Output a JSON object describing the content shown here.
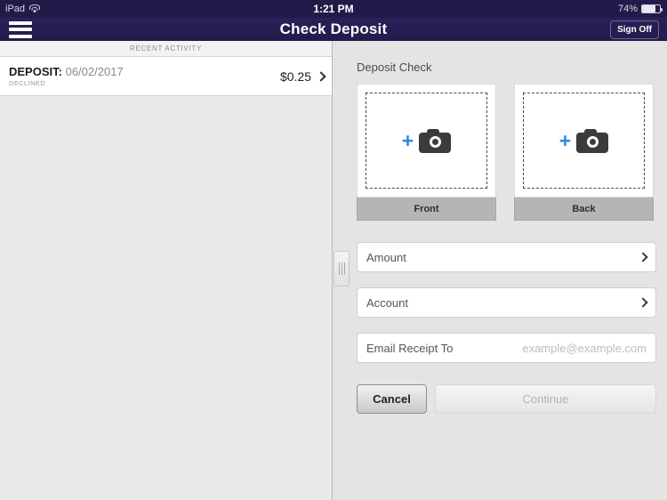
{
  "status_bar": {
    "device": "iPad",
    "wifi_icon": "wifi-icon",
    "time": "1:21 PM",
    "battery_percent": "74%",
    "battery_level": 74
  },
  "nav_bar": {
    "menu_icon": "hamburger-menu-icon",
    "title": "Check Deposit",
    "sign_off_label": "Sign Off"
  },
  "left_panel": {
    "header": "RECENT ACTIVITY",
    "items": [
      {
        "type": "DEPOSIT:",
        "date": "06/02/2017",
        "status": "DECLINED",
        "amount": "$0.25",
        "chevron_icon": "chevron-right-icon"
      }
    ]
  },
  "splitter": {
    "icon": "split-handle-icon"
  },
  "right_panel": {
    "section_title": "Deposit Check",
    "captures": [
      {
        "label": "Front",
        "plus_icon": "plus-icon",
        "camera_icon": "camera-icon"
      },
      {
        "label": "Back",
        "plus_icon": "plus-icon",
        "camera_icon": "camera-icon"
      }
    ],
    "fields": [
      {
        "label": "Amount",
        "value": "",
        "placeholder": "",
        "chevron_icon": "chevron-right-icon"
      },
      {
        "label": "Account",
        "value": "",
        "placeholder": "",
        "chevron_icon": "chevron-right-icon"
      },
      {
        "label": "Email Receipt To",
        "value": "",
        "placeholder": "example@example.com"
      }
    ],
    "buttons": {
      "cancel_label": "Cancel",
      "continue_label": "Continue"
    }
  },
  "colors": {
    "nav_background": "#241a4a",
    "accent_blue": "#2a8ae8",
    "panel_background": "#e4e4e4",
    "camera_dark": "#3b3b3b"
  }
}
